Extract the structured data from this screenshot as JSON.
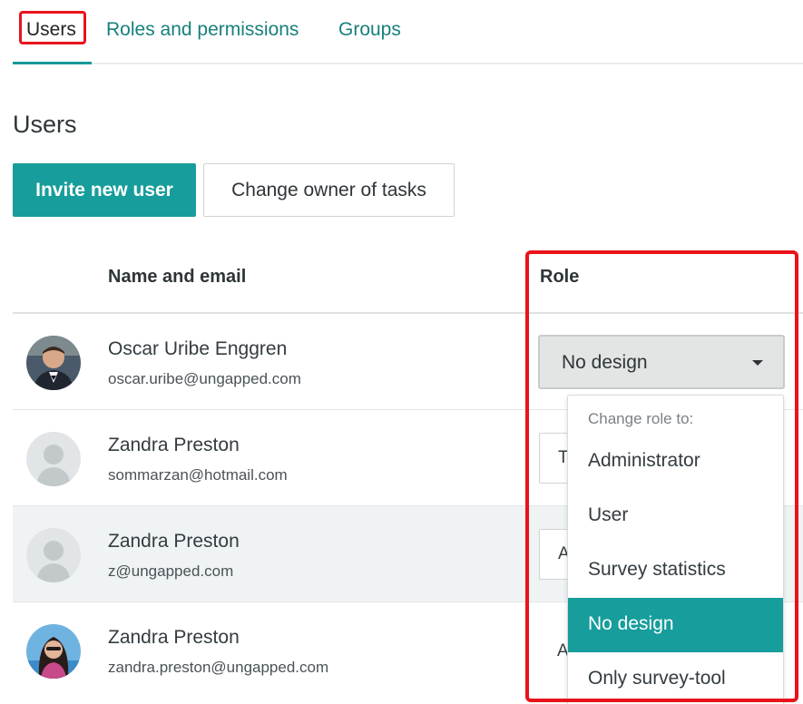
{
  "tabs": [
    {
      "label": "Users",
      "active": true
    },
    {
      "label": "Roles and permissions",
      "active": false
    },
    {
      "label": "Groups",
      "active": false
    }
  ],
  "page_title": "Users",
  "actions": {
    "invite_label": "Invite new user",
    "change_owner_label": "Change owner of tasks"
  },
  "table": {
    "headers": {
      "name": "Name and email",
      "role": "Role"
    },
    "rows": [
      {
        "name": "Oscar Uribe Enggren",
        "email": "oscar.uribe@ungapped.com",
        "role": "No design",
        "avatar": "photo-avatar"
      },
      {
        "name": "Zandra Preston",
        "email": "sommarzan@hotmail.com",
        "role_visible": "T",
        "avatar": "placeholder-avatar"
      },
      {
        "name": "Zandra Preston",
        "email": "z@ungapped.com",
        "role_visible": "A",
        "avatar": "placeholder-avatar"
      },
      {
        "name": "Zandra Preston",
        "email": "zandra.preston@ungapped.com",
        "role_visible": "A",
        "avatar": "photo-avatar"
      }
    ]
  },
  "role_menu": {
    "header": "Change role to:",
    "options": [
      "Administrator",
      "User",
      "Survey statistics",
      "No design",
      "Only survey-tool"
    ],
    "selected": "No design"
  },
  "colors": {
    "accent": "#179d9b",
    "tab_text": "#17807b",
    "annotation": "#e8131b"
  }
}
